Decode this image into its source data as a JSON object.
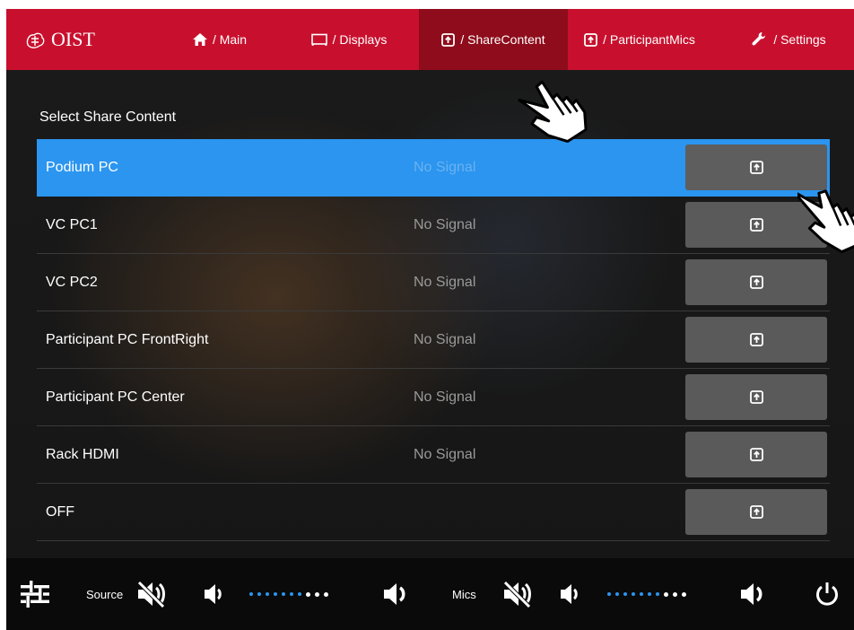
{
  "nav": {
    "logo": "OIST",
    "items": [
      {
        "label": "/ Main",
        "icon": "home-icon"
      },
      {
        "label": "/ Displays",
        "icon": "display-icon"
      },
      {
        "label": "/ ShareContent",
        "icon": "share-icon",
        "active": true
      },
      {
        "label": "/ ParticipantMics",
        "icon": "share-icon"
      },
      {
        "label": "/ Settings",
        "icon": "wrench-icon"
      }
    ]
  },
  "main": {
    "title": "Select Share Content",
    "sources": [
      {
        "name": "Podium PC",
        "status": "No Signal",
        "selected": true
      },
      {
        "name": "VC PC1",
        "status": "No Signal"
      },
      {
        "name": "VC PC2",
        "status": "No Signal"
      },
      {
        "name": "Participant PC FrontRight",
        "status": "No Signal"
      },
      {
        "name": "Participant PC Center",
        "status": "No Signal"
      },
      {
        "name": "Rack HDMI",
        "status": "No Signal"
      },
      {
        "name": "OFF",
        "status": ""
      }
    ]
  },
  "bottom": {
    "source_label": "Source",
    "mics_label": "Mics",
    "source_volume": {
      "level": 7,
      "of": 10
    },
    "mics_volume": {
      "level": 7,
      "of": 10
    }
  },
  "colors": {
    "brand_red": "#c8102e",
    "active_tab": "#8e0c1b",
    "selected_row": "#2b95f0",
    "button_gray": "#5a5a5a"
  }
}
